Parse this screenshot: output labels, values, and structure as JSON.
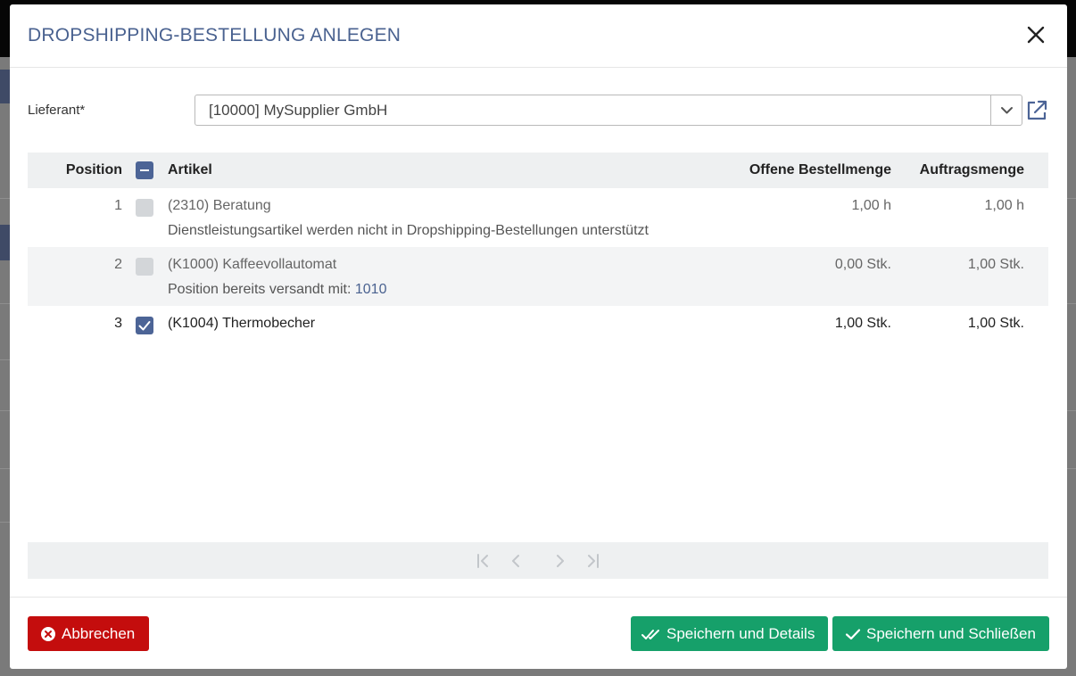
{
  "dialog": {
    "title": "DROPSHIPPING-BESTELLUNG ANLEGEN"
  },
  "supplier": {
    "label": "Lieferant*",
    "value": "[10000] MySupplier GmbH"
  },
  "table": {
    "headers": {
      "position": "Position",
      "artikel": "Artikel",
      "open_qty": "Offene Bestellmenge",
      "order_qty": "Auftragsmenge"
    },
    "rows": [
      {
        "position": "1",
        "artikel": "(2310) Beratung",
        "note": "Dienstleistungsartikel werden nicht in Dropshipping-Bestellungen unterstützt",
        "note_link": "",
        "open_qty": "1,00 h",
        "order_qty": "1,00 h",
        "state": "disabled"
      },
      {
        "position": "2",
        "artikel": "(K1000) Kaffeevollautomat",
        "note": "Position bereits versandt mit: ",
        "note_link": "1010",
        "open_qty": "0,00 Stk.",
        "order_qty": "1,00 Stk.",
        "state": "disabled"
      },
      {
        "position": "3",
        "artikel": "(K1004) Thermobecher",
        "note": "",
        "note_link": "",
        "open_qty": "1,00 Stk.",
        "order_qty": "1,00 Stk.",
        "state": "checked"
      }
    ]
  },
  "footer": {
    "cancel_label": "Abbrechen",
    "save_details_label": "Speichern und Details",
    "save_close_label": "Speichern und Schließen"
  },
  "colors": {
    "title": "#4a6290",
    "checkbox_active": "#4c6496",
    "cancel": "#c40d0d",
    "save": "#16a06a"
  }
}
